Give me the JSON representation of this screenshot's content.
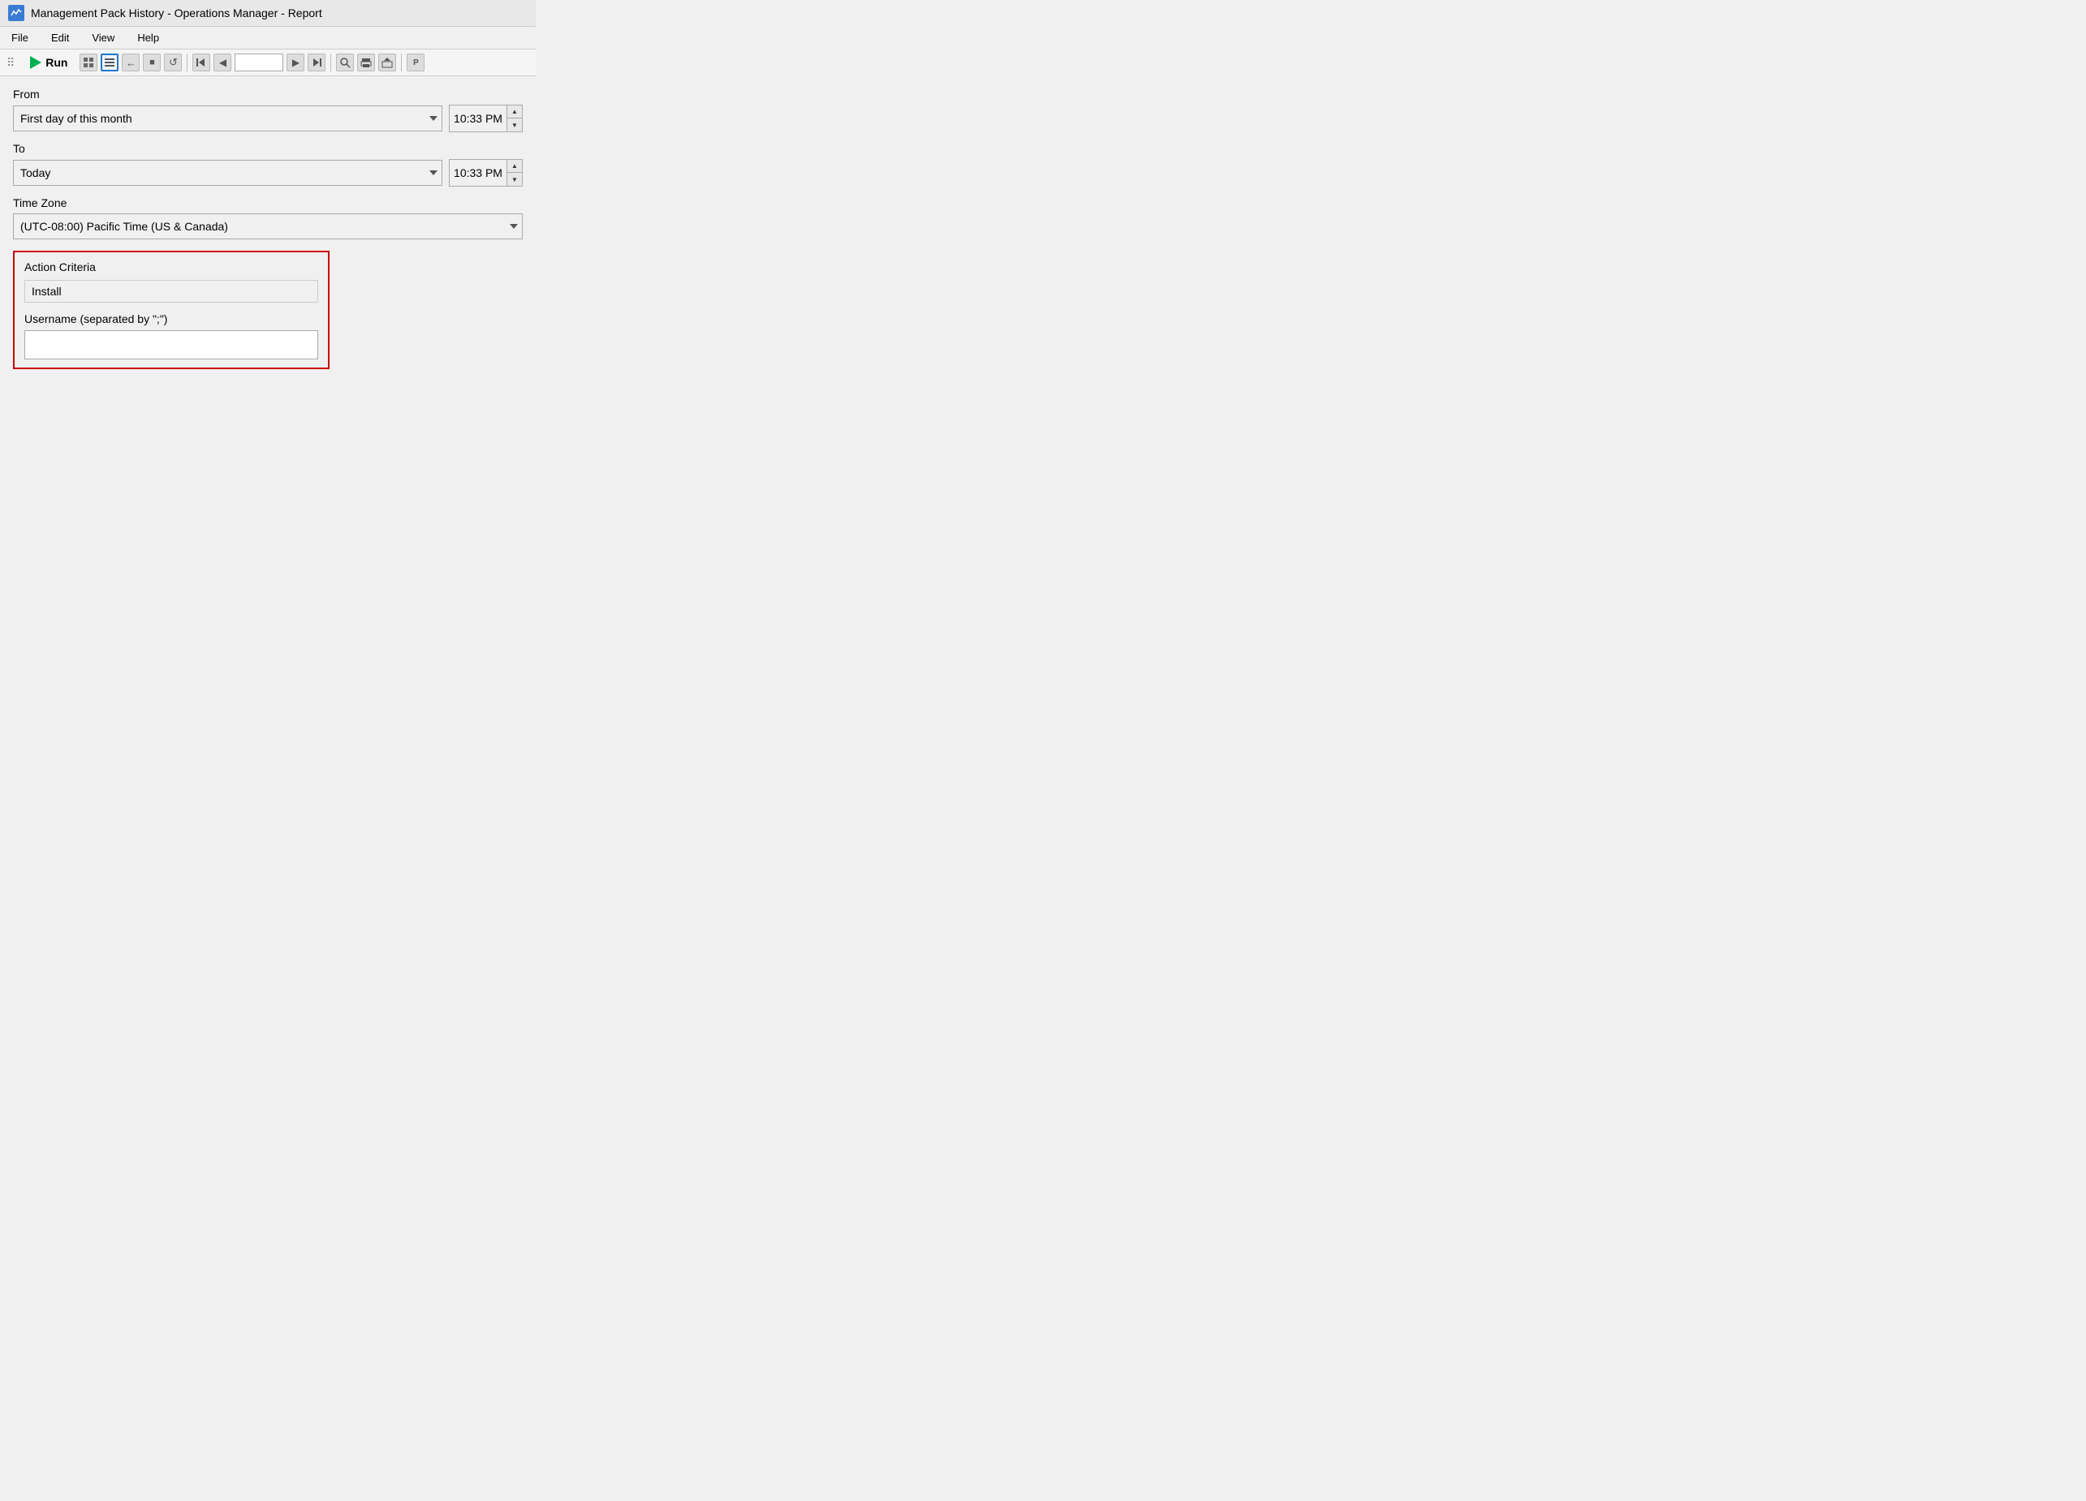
{
  "titleBar": {
    "title": "Management Pack History - Operations Manager - Report",
    "iconLabel": "app-icon"
  },
  "menuBar": {
    "items": [
      {
        "label": "File",
        "id": "file"
      },
      {
        "label": "Edit",
        "id": "edit"
      },
      {
        "label": "View",
        "id": "view"
      },
      {
        "label": "Help",
        "id": "help"
      }
    ]
  },
  "toolbar": {
    "runLabel": "Run",
    "pageValue": ""
  },
  "form": {
    "fromLabel": "From",
    "fromDropdownValue": "First day of this month",
    "fromTimeValue": "10:33 PM",
    "toLabel": "To",
    "toDropdownValue": "Today",
    "toTimeValue": "10:33 PM",
    "timezoneLabel": "Time Zone",
    "timezoneDropdownValue": "(UTC-08:00) Pacific Time (US & Canada)",
    "criteriaSection": {
      "actionCriteriaLabel": "Action Criteria",
      "actionCriteriaValue": "Install",
      "usernameLabel": "Username (separated by \";\")",
      "usernameValue": ""
    }
  },
  "icons": {
    "play": "▶",
    "grid1": "▦",
    "grid2": "▤",
    "back": "←",
    "stop": "■",
    "refresh": "↺",
    "first": "⏮",
    "prev": "◀",
    "next": "▶",
    "last": "⏭",
    "zoom": "🔍",
    "print": "🖨",
    "export": "📤",
    "spinUp": "▲",
    "spinDown": "▼",
    "chevronDown": "▾"
  }
}
